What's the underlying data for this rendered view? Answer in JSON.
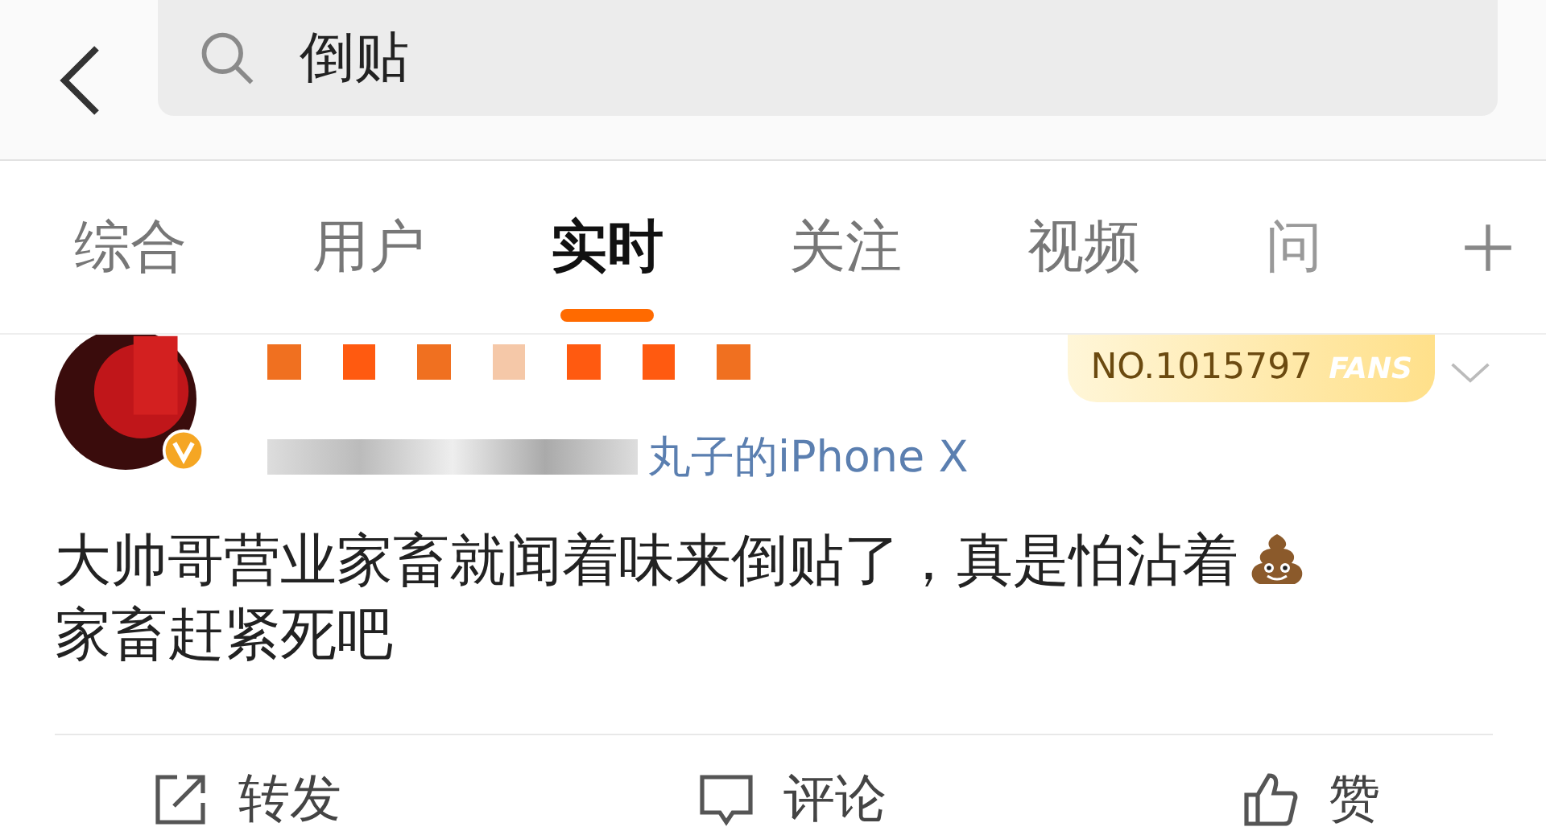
{
  "search": {
    "value": "倒贴"
  },
  "tabs": [
    {
      "label": "综合",
      "selected": false
    },
    {
      "label": "用户",
      "selected": false
    },
    {
      "label": "实时",
      "selected": true
    },
    {
      "label": "关注",
      "selected": false
    },
    {
      "label": "视频",
      "selected": false
    },
    {
      "label": "问",
      "selected": false
    }
  ],
  "post": {
    "badge": {
      "number": "NO.1015797",
      "tag": "FANS"
    },
    "source": "丸子的iPhone X",
    "text_before_icon": "大帅哥营业家畜就闻着味来倒贴了，真是怕沾着",
    "text_after_icon": "家畜赶紧死吧"
  },
  "actions": [
    {
      "kind": "share",
      "label": "转发"
    },
    {
      "kind": "comment",
      "label": "评论"
    },
    {
      "kind": "like",
      "label": "赞"
    }
  ]
}
